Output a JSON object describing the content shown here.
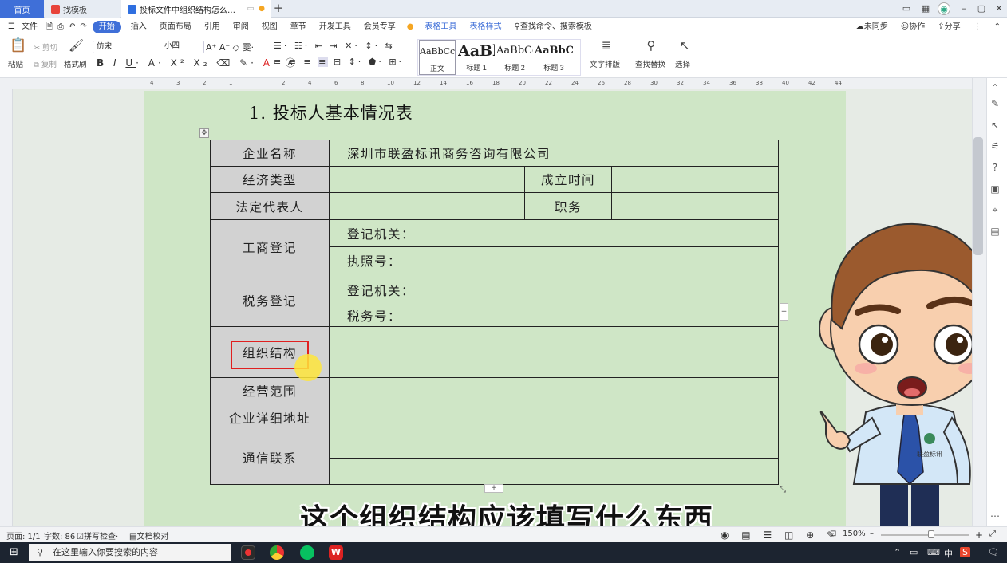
{
  "titlebar": {
    "tabs": [
      {
        "label": "首页",
        "active": false
      },
      {
        "label": "找模板",
        "active": false
      },
      {
        "label": "投标文件中组织结构怎么填.docx",
        "active": true
      }
    ],
    "new_tab": "+",
    "colors": {
      "tab_home": "#3f6fd8",
      "accent_dot": "#f5a623"
    }
  },
  "menubar": {
    "items": [
      "文件",
      "开始",
      "插入",
      "页面布局",
      "引用",
      "审阅",
      "视图",
      "章节",
      "开发工具",
      "会员专享",
      "表格工具",
      "表格样式"
    ],
    "search": "查找命令、搜索模板",
    "right": [
      "未同步",
      "协作",
      "分享"
    ]
  },
  "ribbon": {
    "paste": "粘贴",
    "cut": "剪切",
    "copy": "复制",
    "format_painter": "格式刷",
    "font_name": "仿宋",
    "font_size": "小四",
    "styles": [
      {
        "preview": "AaBbCcI",
        "label": "正文"
      },
      {
        "preview": "AaBl",
        "label": "标题 1"
      },
      {
        "preview": "AaBbCc",
        "label": "标题 2"
      },
      {
        "preview": "AaBbC",
        "label": "标题 3"
      }
    ],
    "text_layout": "文字排版",
    "find_replace": "查找替换",
    "select": "选择"
  },
  "ruler": {
    "ticks": [
      "4",
      "3",
      "2",
      "1",
      "",
      "2",
      "4",
      "6",
      "8",
      "10",
      "12",
      "14",
      "16",
      "18",
      "20",
      "22",
      "24",
      "26",
      "28",
      "30",
      "32",
      "34",
      "36",
      "38",
      "40",
      "42",
      "44"
    ]
  },
  "document": {
    "heading": "1. 投标人基本情况表",
    "table": {
      "company_name_label": "企业名称",
      "company_name_value": "深圳市联盈标讯商务咨询有限公司",
      "economic_type_label": "经济类型",
      "established_label": "成立时间",
      "legal_rep_label": "法定代表人",
      "position_label": "职务",
      "business_reg_label": "工商登记",
      "reg_authority_1": "登记机关：",
      "license_no": "执照号：",
      "tax_reg_label": "税务登记",
      "reg_authority_2": "登记机关：",
      "tax_no": "税务号：",
      "org_structure_label": "组织结构",
      "business_scope_label": "经营范围",
      "address_label": "企业详细地址",
      "contact_label": "通信联系"
    }
  },
  "subtitle": "这个组织结构应该填写什么东西",
  "statusbar": {
    "page": "页面: 1/1",
    "word_count": "字数: 86",
    "spell_check": "拼写检查",
    "doc_proof": "文档校对",
    "zoom": "150%"
  },
  "taskbar": {
    "search_placeholder": "在这里输入你要搜索的内容",
    "ime": "中"
  },
  "mascot": {
    "badge": "联盈标讯"
  }
}
